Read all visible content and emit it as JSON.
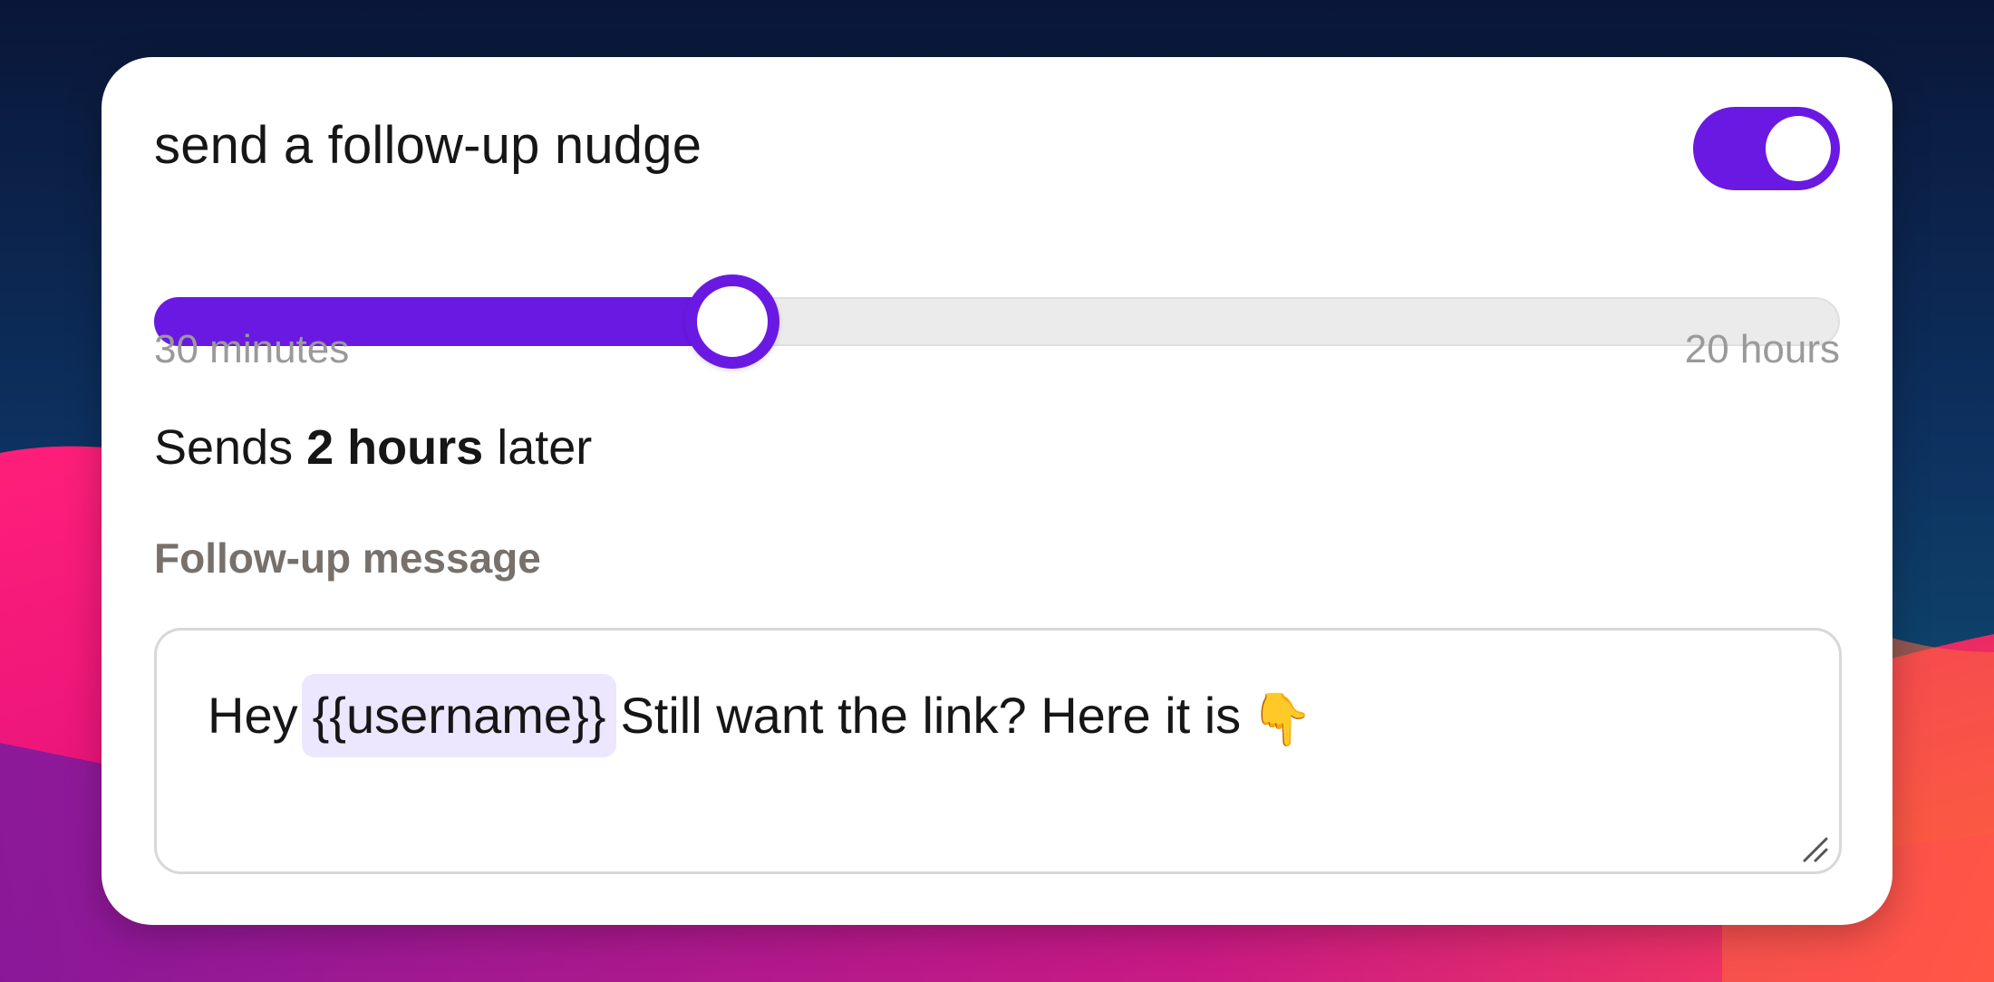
{
  "card": {
    "title": "send a follow-up nudge",
    "toggle": {
      "on": true
    },
    "slider": {
      "min_label": "30 minutes",
      "max_label": "20 hours",
      "value_fraction": 0.343
    },
    "sends": {
      "prefix": "Sends",
      "value": "2 hours",
      "suffix": "later"
    },
    "message": {
      "label": "Follow-up message",
      "text_before": "Hey",
      "token": "{{username}}",
      "text_after": "Still want the link? Here it is",
      "emoji": "👇"
    }
  },
  "colors": {
    "accent": "#6a19e3",
    "token_bg": "#ece6ff",
    "label_gray": "#77706b",
    "muted_gray": "#9a9a9a"
  }
}
